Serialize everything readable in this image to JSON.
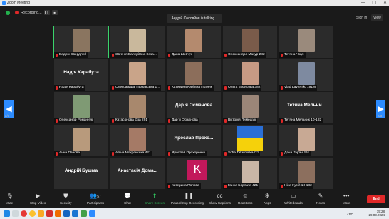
{
  "window": {
    "title": "Zoom Meeting",
    "controls": [
      "—",
      "▢",
      "✕"
    ]
  },
  "topbar": {
    "recording_label": "Recording...",
    "talking": "Андрій Соловйов is talking...",
    "signin": "Sign in",
    "view": "View"
  },
  "tiles": [
    {
      "name": "Вадим Свердлий",
      "big": "",
      "photo": "#8a7560"
    },
    {
      "name": "Євгенія Валеріївна Коза...",
      "big": "",
      "photo": "#c9b89c"
    },
    {
      "name": "Дана Шевчук",
      "big": "",
      "photo": "#b48a6e"
    },
    {
      "name": "Олександра Мазур 282",
      "big": "",
      "photo": "#7a5b4a"
    },
    {
      "name": "Тетяна Чікун",
      "big": "",
      "photo": "#9a8a7c"
    },
    {
      "name": "Надія Карабута",
      "big": "Надія Карабута",
      "photo": ""
    },
    {
      "name": "Олександра Тарнавська 1...",
      "big": "",
      "photo": "#c9a489"
    },
    {
      "name": "Катерина Юріївна Позняк",
      "big": "",
      "photo": "#8c6e5b"
    },
    {
      "name": "Ольга Борисова 382",
      "big": "",
      "photo": "#c79a84"
    },
    {
      "name": "Vlad Lavrenko 191M",
      "big": "",
      "photo": "#7e8aa0"
    },
    {
      "name": "Олександр Романчук",
      "big": "",
      "photo": "#7f9a74"
    },
    {
      "name": "Катасонова Єва 291",
      "big": "",
      "photo": "#a8886d"
    },
    {
      "name": "Дар`я Османова",
      "big": "Дар`я Османова",
      "photo": ""
    },
    {
      "name": "Вікторія Лимещук",
      "big": "",
      "photo": "#9b8678"
    },
    {
      "name": "Тетяна Мельник 10-182",
      "big": "Тетяна Мельни...",
      "photo": ""
    },
    {
      "name": "Анна Панова",
      "big": "",
      "photo": "#b89a7c"
    },
    {
      "name": "Аліна Мокренська 421",
      "big": "",
      "photo": "#a57a66"
    },
    {
      "name": "Ярослав Прохоренко",
      "big": "Ярослав Прохо...",
      "photo": ""
    },
    {
      "name": "Sofia Tatarovska421",
      "big": "",
      "photo": ""
    },
    {
      "name": "Дана Таран 491",
      "big": "",
      "photo": "#c8a994"
    },
    {
      "name": "",
      "big": "Андрій Бушма",
      "photo": ""
    },
    {
      "name": "",
      "big": "Анастасія Дома...",
      "photo": ""
    },
    {
      "name": "Катерина Попова",
      "big": "",
      "photo": ""
    },
    {
      "name": "Ганна Берлата 421",
      "big": "",
      "photo": "#c9b6a6"
    },
    {
      "name": "Ніна Кусій 10-182",
      "big": "",
      "photo": "#8c6f5e"
    }
  ],
  "avatar_letter": "K",
  "pagination": {
    "left": "2/3",
    "right": "2/3"
  },
  "toolbar": {
    "mute": "Mute",
    "stop_video": "Stop Video",
    "security": "Security",
    "participants": "Participants",
    "participants_count": "57",
    "chat": "Chat",
    "share_screen": "Share Screen",
    "pause_recording": "Pause/Stop Recording",
    "captions": "Show Captions",
    "reactions": "Reactions",
    "apps": "Apps",
    "whiteboards": "Whiteboards",
    "notes": "Notes",
    "more": "More",
    "end": "End"
  },
  "taskbar": {
    "lang": "УКР",
    "time": "15:28",
    "date": "29.03.2024"
  }
}
